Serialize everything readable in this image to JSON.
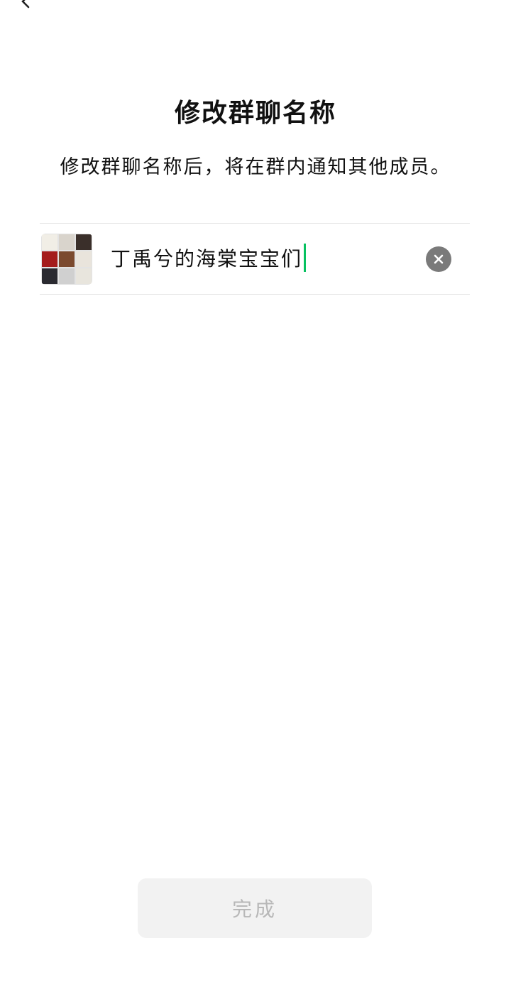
{
  "page": {
    "title": "修改群聊名称",
    "subtitle": "修改群聊名称后，将在群内通知其他成员。"
  },
  "group": {
    "name_value": "丁禹兮的海棠宝宝们",
    "avatar_colors": [
      "#f1eee6",
      "#d9d4cc",
      "#3a2f2a",
      "#a41b1b",
      "#7b4a2f",
      "#e9e4dc",
      "#2a2a30",
      "#d0d0d0",
      "#e8e5dd"
    ]
  },
  "actions": {
    "clear_icon": "clear-icon",
    "back_icon": "back-arrow-icon",
    "done_label": "完成"
  },
  "colors": {
    "accent": "#07c160",
    "button_bg": "#f2f2f2",
    "button_text_disabled": "#b8b8b8"
  }
}
